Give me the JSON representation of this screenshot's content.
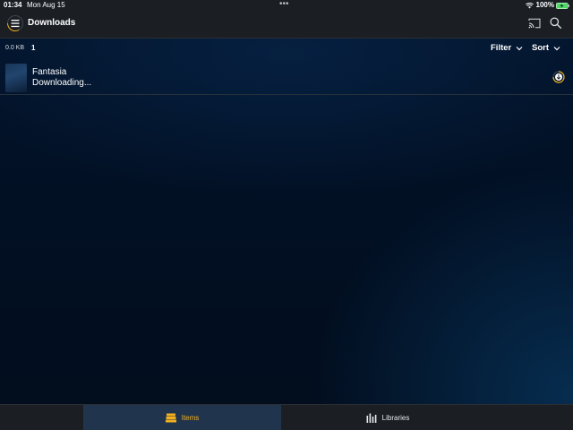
{
  "status_bar": {
    "time": "01:34",
    "date": "Mon Aug 15",
    "dots": "•••",
    "battery_percent": "100%"
  },
  "header": {
    "title": "Downloads"
  },
  "toolbar": {
    "storage_size": "0.0 KB",
    "item_count": "1",
    "filter_label": "Filter",
    "sort_label": "Sort"
  },
  "downloads": [
    {
      "title": "Fantasia",
      "status": "Downloading..."
    }
  ],
  "tabs": [
    {
      "label": "Items",
      "icon": "stack-icon",
      "active": true
    },
    {
      "label": "Libraries",
      "icon": "libraries-icon",
      "active": false
    }
  ],
  "colors": {
    "accent": "#f2b01e",
    "bar_background": "#1b1f24",
    "active_tab_background": "#21344d",
    "page_background": "#021024"
  },
  "icons": [
    "hamburger-menu-icon",
    "cast-icon",
    "search-icon",
    "chevron-down-icon",
    "download-progress-icon",
    "wifi-icon",
    "battery-icon"
  ]
}
